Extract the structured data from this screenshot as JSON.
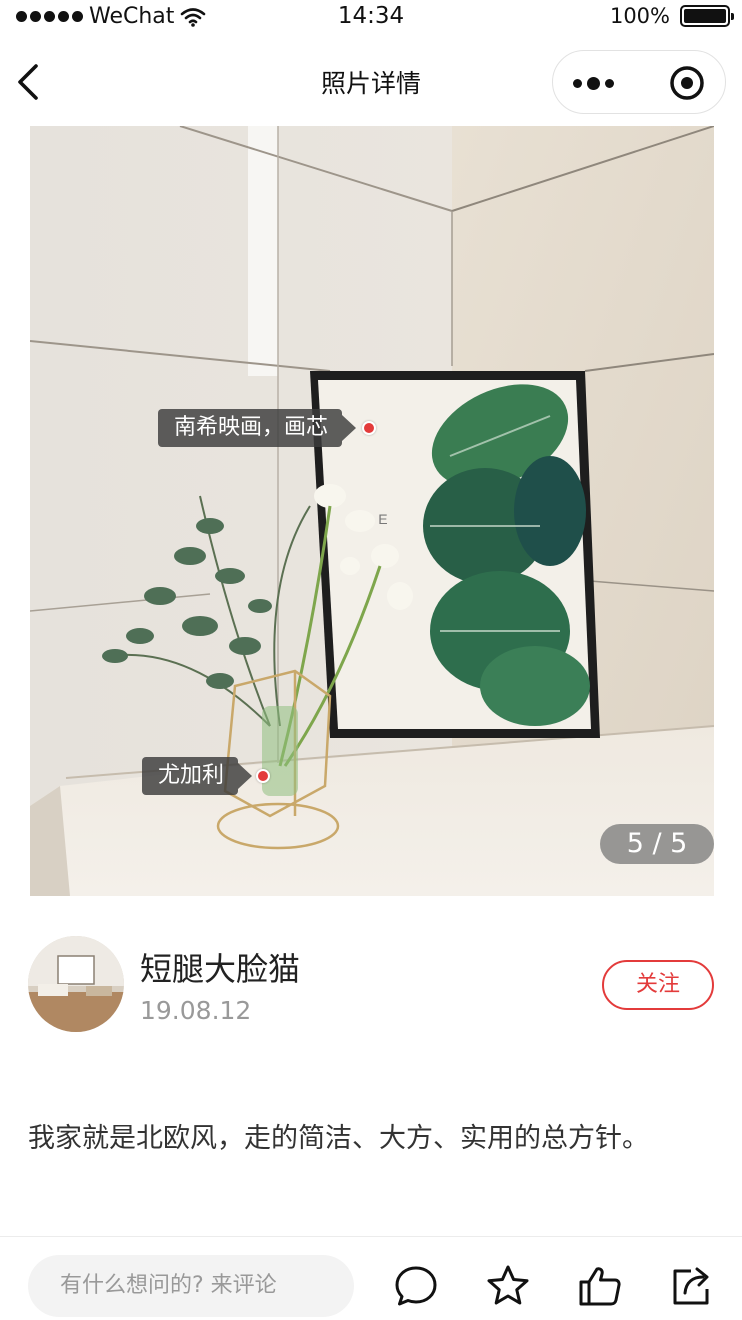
{
  "status_bar": {
    "carrier": "WeChat",
    "time": "14:34",
    "battery": "100%",
    "battery_level": 1.0
  },
  "nav": {
    "title": "照片详情",
    "back_icon": "chevron-left-icon",
    "more_icon": "more-dots-icon",
    "close_icon": "target-close-icon"
  },
  "photo": {
    "tags": [
      {
        "label": "南希映画，画芯"
      },
      {
        "label": "尤加利"
      }
    ],
    "page_indicator": "5 / 5",
    "current_page": 5,
    "total_pages": 5
  },
  "author": {
    "name": "短腿大脸猫",
    "date": "19.08.12",
    "follow_label": "关注"
  },
  "post": {
    "description": "我家就是北欧风，走的简洁、大方、实用的总方针。"
  },
  "bottom_bar": {
    "comment_placeholder": "有什么想问的? 来评论",
    "icons": [
      "comment-icon",
      "star-icon",
      "like-icon",
      "share-icon"
    ]
  },
  "colors": {
    "accent": "#e33b3b",
    "text_primary": "#222222",
    "text_secondary": "#999999",
    "input_bg": "#f3f3f3"
  }
}
